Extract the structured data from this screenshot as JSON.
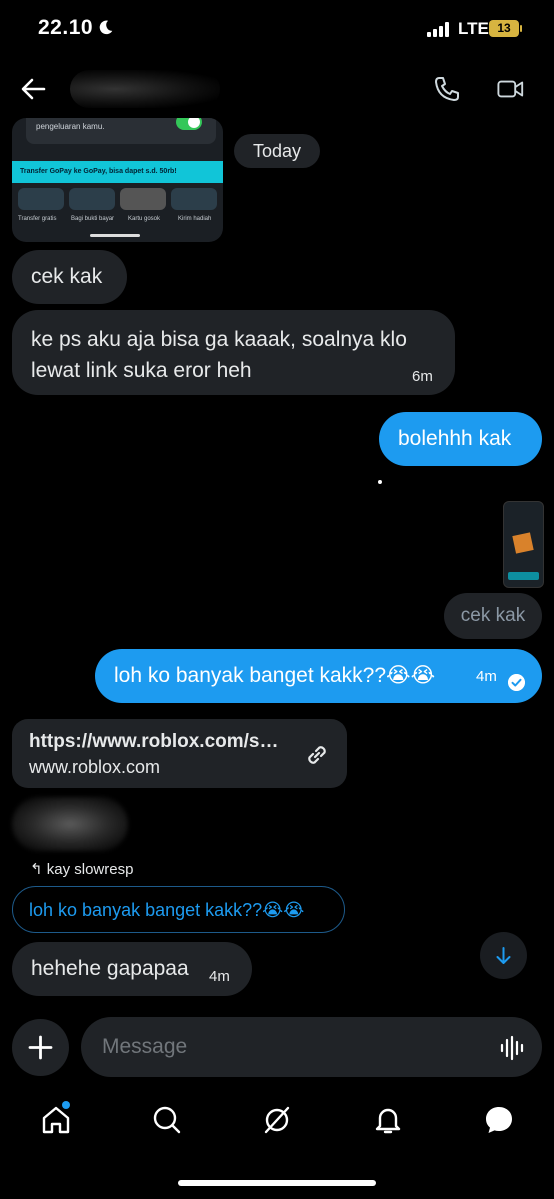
{
  "status_bar": {
    "time": "22.10",
    "network": "LTE",
    "battery": "13"
  },
  "header": {
    "back_icon": "arrow-left-icon",
    "call_icon": "phone-icon",
    "video_icon": "video-camera-icon"
  },
  "image_top": {
    "text1": "pengeluaran kamu.",
    "banner": "Transfer GoPay ke GoPay, bisa dapet s.d. 50rb!",
    "tiles": [
      "Transfer gratis",
      "Bagi bukti bayar",
      "Kartu gosok",
      "Kirim hadiah"
    ]
  },
  "date_separator": "Today",
  "messages": [
    {
      "direction": "in",
      "text": "cek kak"
    },
    {
      "direction": "in",
      "lines": [
        "ke ps aku aja bisa ga kaaak, soalnya klo",
        "lewat link suka eror heh"
      ],
      "time": "6m"
    },
    {
      "direction": "out",
      "text": "bolehhh kak"
    },
    {
      "direction": "out",
      "text": "cek kak",
      "style": "muted"
    },
    {
      "direction": "out",
      "text": "loh ko banyak banget kakk??😭😭",
      "time": "4m"
    },
    {
      "direction": "in",
      "type": "link",
      "url": "https://www.roblox.com/s…",
      "domain": "www.roblox.com"
    },
    {
      "direction": "in",
      "reply_to_label": "kay slowresp",
      "reply_to_text": "loh ko banyak banget kakk??😭😭"
    },
    {
      "direction": "in",
      "text": "hehehe gapapaa",
      "time": "4m"
    }
  ],
  "composer": {
    "placeholder": "Message",
    "add_icon": "plus-icon",
    "voice_icon": "audio-wave-icon"
  },
  "bottom_nav": [
    "home-icon",
    "search-icon",
    "grok-icon",
    "bell-icon",
    "messages-icon"
  ],
  "colors": {
    "accent": "#1d9bf0",
    "bubble_in": "#202327",
    "background": "#000000"
  }
}
